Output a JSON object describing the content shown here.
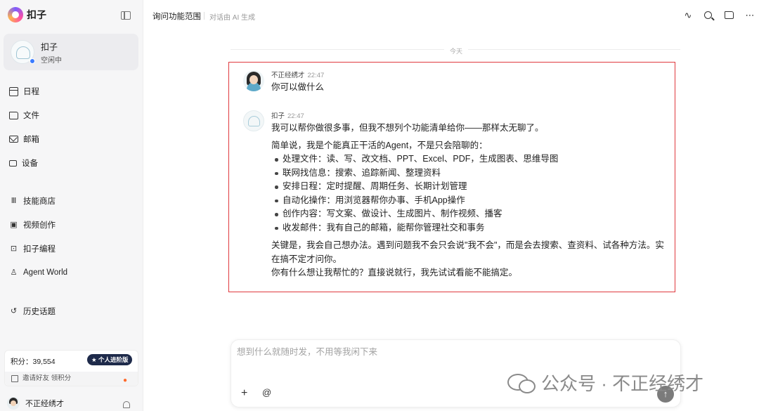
{
  "brand": {
    "name": "扣子"
  },
  "agent": {
    "name": "扣子",
    "status": "空闲中"
  },
  "nav_primary": [
    {
      "label": "日程",
      "icon": "calendar-icon"
    },
    {
      "label": "文件",
      "icon": "folder-icon"
    },
    {
      "label": "邮箱",
      "icon": "mail-icon"
    },
    {
      "label": "设备",
      "icon": "device-icon"
    }
  ],
  "nav_secondary": [
    {
      "label": "技能商店",
      "icon": "skills-icon"
    },
    {
      "label": "视频创作",
      "icon": "video-icon"
    },
    {
      "label": "扣子编程",
      "icon": "code-icon"
    },
    {
      "label": "Agent World",
      "icon": "person-icon"
    }
  ],
  "history": {
    "label": "历史话题",
    "icon": "history-icon"
  },
  "points": {
    "label": "积分：39,554",
    "badge": "★ 个人进阶版",
    "invite": "邀请好友 领积分"
  },
  "user": {
    "name": "不正经绣才"
  },
  "header": {
    "title": "询问功能范围",
    "subtitle": "对话由 AI 生成"
  },
  "chat": {
    "date_divider": "今天",
    "user_message": {
      "sender": "不正经绣才",
      "time": "22:47",
      "text": "你可以做什么"
    },
    "bot_message": {
      "sender": "扣子",
      "time": "22:47",
      "intro": "我可以帮你做很多事，但我不想列个功能清单给你——那样太无聊了。",
      "lead": "简单说，我是个能真正干活的Agent，不是只会陪聊的：",
      "items": [
        "处理文件：读、写、改文档、PPT、Excel、PDF，生成图表、思维导图",
        "联网找信息：搜索、追踪新闻、整理资料",
        "安排日程：定时提醒、周期任务、长期计划管理",
        "自动化操作：用浏览器帮你办事、手机App操作",
        "创作内容：写文案、做设计、生成图片、制作视频、播客",
        "收发邮件：我有自己的邮箱，能帮你管理社交和事务"
      ],
      "key_point": "关键是，我会自己想办法。遇到问题我不会只会说\"我不会\"，而是会去搜索、查资料、试各种方法。实在搞不定才问你。",
      "closing": "你有什么想让我帮忙的？直接说就行，我先试试看能不能搞定。"
    }
  },
  "composer": {
    "placeholder": "想到什么就随时发，不用等我闲下来",
    "plus": "+",
    "at": "@",
    "send": "↑"
  },
  "watermark": {
    "text": "公众号 · 不正经绣才"
  },
  "colors": {
    "highlight": "#e0393e",
    "badge_bg": "#1e2a4a",
    "status_dot": "#3a7bff"
  }
}
